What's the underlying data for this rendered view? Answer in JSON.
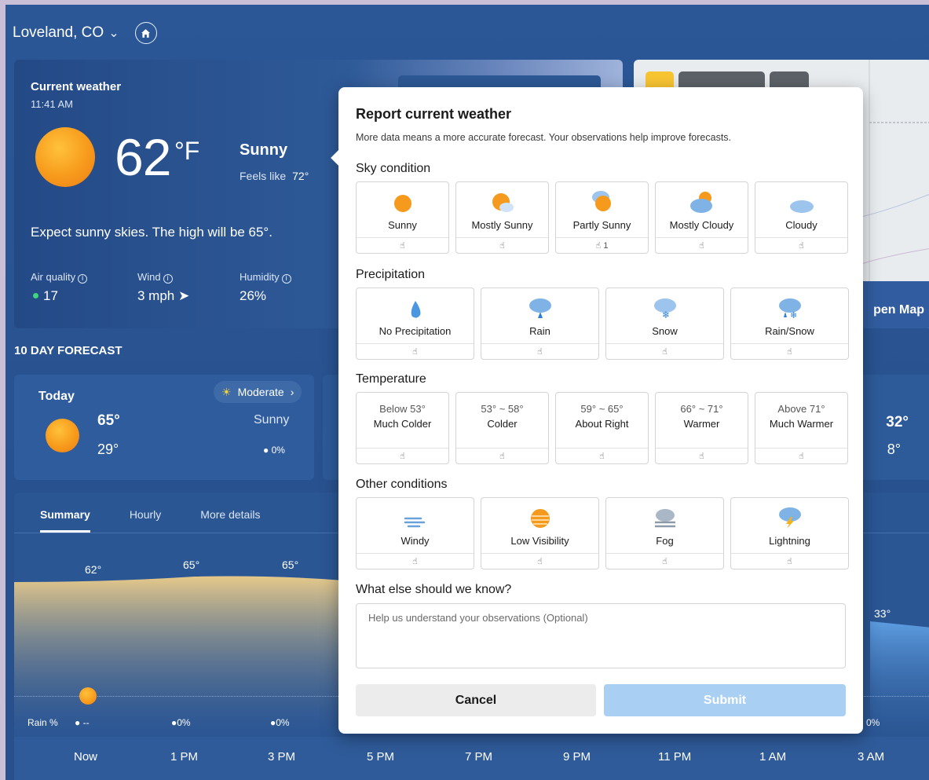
{
  "header": {
    "location": "Loveland, CO"
  },
  "current": {
    "title": "Current weather",
    "time": "11:41 AM",
    "temp": "62",
    "unit": "°F",
    "condition": "Sunny",
    "feels_label": "Feels like",
    "feels_value": "72°",
    "summary": "Expect sunny skies. The high will be 65°.",
    "metrics": [
      {
        "label": "Air quality",
        "value": "17"
      },
      {
        "label": "Wind",
        "value": "3 mph"
      },
      {
        "label": "Humidity",
        "value": "26%"
      }
    ]
  },
  "map": {
    "open_label": "pen Map"
  },
  "forecast": {
    "title": "10 DAY FORECAST",
    "today": {
      "day": "Today",
      "high": "65°",
      "low": "29°",
      "condition": "Sunny",
      "rain": "0%",
      "aq_label": "Moderate"
    },
    "right_high": "32°",
    "right_low": "8°"
  },
  "summary": {
    "tabs": [
      "Summary",
      "Hourly",
      "More details"
    ],
    "temps": [
      "62°",
      "65°",
      "65°"
    ],
    "right_temp": "33°",
    "rain_label": "Rain %",
    "rain_values": [
      "--",
      "0%",
      "0%"
    ],
    "right_rain": "0%",
    "hours": [
      "Now",
      "1 PM",
      "3 PM",
      "5 PM",
      "7 PM",
      "9 PM",
      "11 PM",
      "1 AM",
      "3 AM"
    ]
  },
  "dialog": {
    "title": "Report current weather",
    "subtitle": "More data means a more accurate forecast. Your observations help improve forecasts.",
    "sky_title": "Sky condition",
    "sky": [
      {
        "label": "Sunny",
        "votes": ""
      },
      {
        "label": "Mostly Sunny",
        "votes": ""
      },
      {
        "label": "Partly Sunny",
        "votes": "1"
      },
      {
        "label": "Mostly Cloudy",
        "votes": ""
      },
      {
        "label": "Cloudy",
        "votes": ""
      }
    ],
    "precip_title": "Precipitation",
    "precip": [
      {
        "label": "No Precipitation"
      },
      {
        "label": "Rain"
      },
      {
        "label": "Snow"
      },
      {
        "label": "Rain/Snow"
      }
    ],
    "temp_title": "Temperature",
    "temps": [
      {
        "range": "Below 53°",
        "label": "Much Colder"
      },
      {
        "range": "53° ~ 58°",
        "label": "Colder"
      },
      {
        "range": "59° ~ 65°",
        "label": "About Right"
      },
      {
        "range": "66° ~ 71°",
        "label": "Warmer"
      },
      {
        "range": "Above 71°",
        "label": "Much Warmer"
      }
    ],
    "other_title": "Other conditions",
    "other": [
      {
        "label": "Windy"
      },
      {
        "label": "Low Visibility"
      },
      {
        "label": "Fog"
      },
      {
        "label": "Lightning"
      }
    ],
    "notes_title": "What else should we know?",
    "notes_placeholder": "Help us understand your observations (Optional)",
    "cancel": "Cancel",
    "submit": "Submit"
  },
  "colors": {
    "accent": "#a9d0f2",
    "background": "#2b5796",
    "sun": "#f79a1c"
  }
}
